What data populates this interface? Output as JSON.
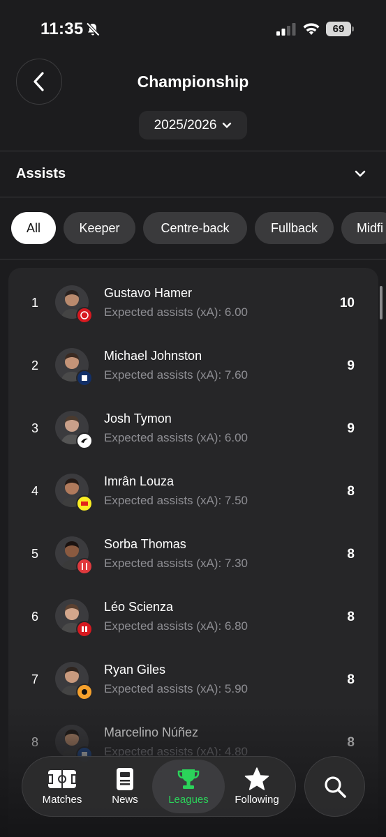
{
  "status_bar": {
    "time": "11:35",
    "battery": "69"
  },
  "header": {
    "title": "Championship",
    "season": "2025/2026"
  },
  "stat_selector": {
    "label": "Assists"
  },
  "filters": [
    "All",
    "Keeper",
    "Centre-back",
    "Fullback",
    "Midfi"
  ],
  "players": [
    {
      "rank": "1",
      "name": "Gustavo Hamer",
      "xa": "Expected assists (xA): 6.00",
      "assists": "10",
      "badge_color": "#d71920"
    },
    {
      "rank": "2",
      "name": "Michael Johnston",
      "xa": "Expected assists (xA): 7.60",
      "assists": "9",
      "badge_color": "#122f67"
    },
    {
      "rank": "3",
      "name": "Josh Tymon",
      "xa": "Expected assists (xA): 6.00",
      "assists": "9",
      "badge_color": "#ffffff"
    },
    {
      "rank": "4",
      "name": "Imrân Louza",
      "xa": "Expected assists (xA): 7.50",
      "assists": "8",
      "badge_color": "#fbee23"
    },
    {
      "rank": "5",
      "name": "Sorba Thomas",
      "xa": "Expected assists (xA): 7.30",
      "assists": "8",
      "badge_color": "#e03a3e"
    },
    {
      "rank": "6",
      "name": "Léo Scienza",
      "xa": "Expected assists (xA): 6.80",
      "assists": "8",
      "badge_color": "#d71920"
    },
    {
      "rank": "7",
      "name": "Ryan Giles",
      "xa": "Expected assists (xA): 5.90",
      "assists": "8",
      "badge_color": "#f5a12d"
    },
    {
      "rank": "8",
      "name": "Marcelino Núñez",
      "xa": "Expected assists (xA): 4.80",
      "assists": "8",
      "badge_color": "#1c4ea0"
    }
  ],
  "tabs": [
    {
      "label": "Matches",
      "icon": "pitch-icon"
    },
    {
      "label": "News",
      "icon": "news-icon"
    },
    {
      "label": "Leagues",
      "icon": "trophy-icon"
    },
    {
      "label": "Following",
      "icon": "star-icon"
    }
  ],
  "colors": {
    "accent": "#2bd35a",
    "background": "#1c1c1e",
    "card": "#262628"
  }
}
